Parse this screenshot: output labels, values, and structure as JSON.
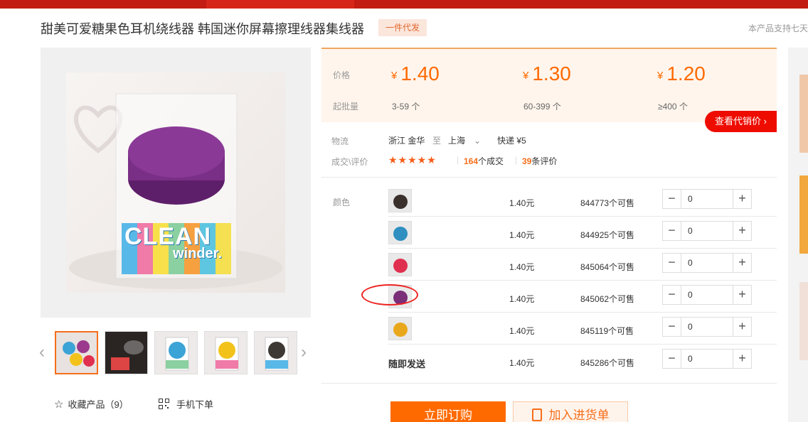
{
  "product": {
    "title": "甜美可爱糖果色耳机绕线器 韩国迷你屏幕擦理线器集线器",
    "tag": "一件代发",
    "notice": "本产品支持七天"
  },
  "price_panel": {
    "price_label": "价格",
    "moq_label": "起批量",
    "currency": "¥",
    "tiers": [
      {
        "price": "1.40",
        "range": "3-59 个"
      },
      {
        "price": "1.30",
        "range": "60-399 个"
      },
      {
        "price": "1.20",
        "range": "≥400 个"
      }
    ]
  },
  "agent_button": "查看代销价 ›",
  "logistics": {
    "label": "物流",
    "from": "浙江 金华",
    "to_word": "至",
    "to": "上海",
    "shipping": "快递 ¥5"
  },
  "rating": {
    "label": "成交\\评价",
    "stars": "★★★★★",
    "deals_count": "164",
    "deals_suffix": "个成交",
    "reviews_count": "39",
    "reviews_suffix": "条评价"
  },
  "colors": {
    "label": "颜色",
    "rows": [
      {
        "swatch": "#3a302c",
        "name": "",
        "price": "1.40元",
        "stock": "844773个可售",
        "qty": "0"
      },
      {
        "swatch": "#2f8fc0",
        "name": "",
        "price": "1.40元",
        "stock": "844925个可售",
        "qty": "0"
      },
      {
        "swatch": "#e03050",
        "name": "",
        "price": "1.40元",
        "stock": "845064个可售",
        "qty": "0"
      },
      {
        "swatch": "#7a2f78",
        "name": "",
        "price": "1.40元",
        "stock": "845062个可售",
        "qty": "0"
      },
      {
        "swatch": "#e9a81c",
        "name": "",
        "price": "1.40元",
        "stock": "845119个可售",
        "qty": "0"
      },
      {
        "swatch": "",
        "name": "随即发送",
        "price": "1.40元",
        "stock": "845286个可售",
        "qty": "0"
      }
    ]
  },
  "gallery": {
    "main_text": "CLEAN",
    "main_sub": "winder.",
    "thumb_colors": [
      "#9b3a8c",
      "#222222",
      "#3ba3d6",
      "#f2c21b",
      "#3e3834"
    ]
  },
  "actions": {
    "favorite": "收藏产品（9）",
    "mobile_order": "手机下单",
    "buy_now": "立即订购",
    "add_cart": "加入进货单"
  }
}
